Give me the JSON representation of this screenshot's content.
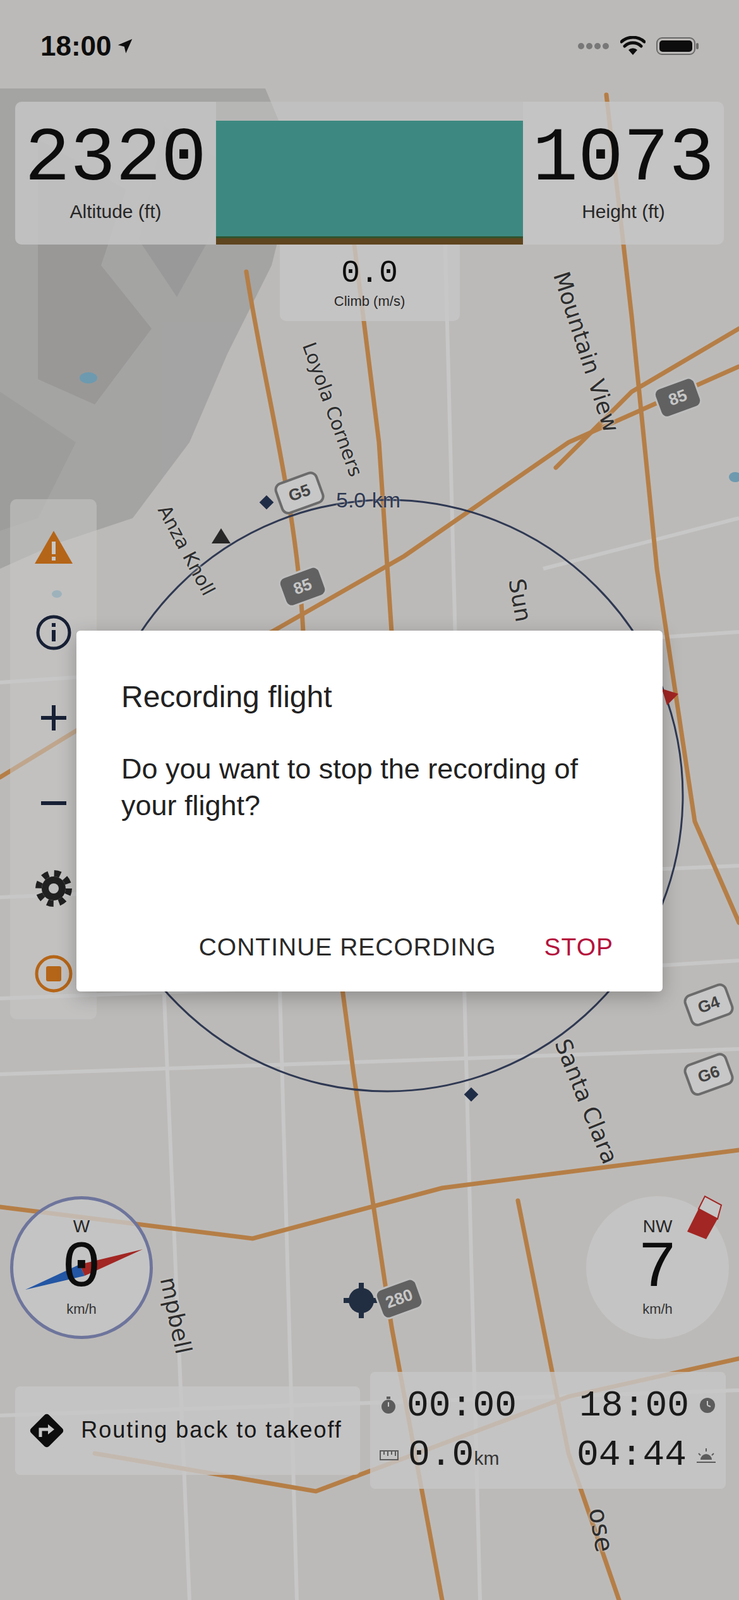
{
  "status_bar": {
    "time": "18:00"
  },
  "instruments": {
    "altitude": {
      "value": "2320",
      "label": "Altitude (ft)"
    },
    "bar": {
      "level": 1
    },
    "height": {
      "value": "1073",
      "label": "Height (ft)"
    },
    "climb": {
      "value": "0.0",
      "label": "Climb (m/s)"
    }
  },
  "map": {
    "labels": [
      "Mountain View",
      "Loyola Corners",
      "Anza Knoll",
      "Sun",
      "Santa Clara",
      "mpbell",
      "ose"
    ],
    "shields": [
      {
        "text": "85",
        "kind": "highway"
      },
      {
        "text": "G5",
        "kind": "county"
      },
      {
        "text": "85",
        "kind": "highway"
      },
      {
        "text": "G4",
        "kind": "county"
      },
      {
        "text": "G6",
        "kind": "county"
      },
      {
        "text": "280",
        "kind": "highway"
      }
    ],
    "range_label": "5.0 km"
  },
  "toolbar": [
    {
      "kind": "warning"
    },
    {
      "kind": "info"
    },
    {
      "kind": "zoom-in"
    },
    {
      "kind": "zoom-out"
    },
    {
      "kind": "settings"
    },
    {
      "kind": "recording"
    }
  ],
  "speed": {
    "direction": "W",
    "value": "0",
    "unit": "km/h"
  },
  "wind": {
    "direction": "NW",
    "value": "7",
    "unit": "km/h"
  },
  "navigation": {
    "text": "Routing back to takeoff"
  },
  "stats": [
    {
      "kind": "timer",
      "value": "00:00"
    },
    {
      "kind": "clock",
      "value": "18:00"
    },
    {
      "kind": "distance",
      "value": "0.0",
      "unit": "km"
    },
    {
      "kind": "sunset",
      "value": "04:44"
    }
  ],
  "dialog": {
    "title": "Recording flight",
    "message": "Do you want to stop the recording of your flight?",
    "buttons": [
      {
        "label": "CONTINUE RECORDING",
        "kind": "neutral"
      },
      {
        "label": "STOP",
        "kind": "destructive"
      }
    ]
  }
}
